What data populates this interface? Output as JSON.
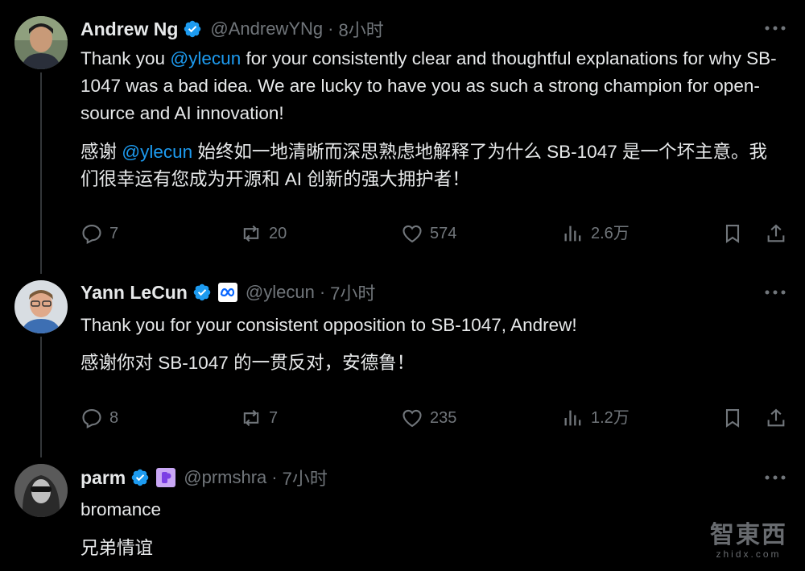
{
  "tweets": [
    {
      "name": "Andrew Ng",
      "handle": "@AndrewYNg",
      "time": "8小时",
      "text_en_pre": "Thank you ",
      "mention_en": "@ylecun",
      "text_en_post": " for your consistently clear and thoughtful explanations for why SB-1047 was a bad idea. We are lucky to have you as such a strong champion for open-source and AI innovation!",
      "text_zh_pre": "感谢 ",
      "mention_zh": "@ylecun",
      "text_zh_post": " 始终如一地清晰而深思熟虑地解释了为什么 SB-1047 是一个坏主意。我们很幸运有您成为开源和 AI 创新的强大拥护者！",
      "replies": "7",
      "reposts": "20",
      "likes": "574",
      "views": "2.6万"
    },
    {
      "name": "Yann LeCun",
      "handle": "@ylecun",
      "time": "7小时",
      "text_en": "Thank you for your consistent opposition to SB-1047, Andrew!",
      "text_zh": "感谢你对 SB-1047 的一贯反对，安德鲁！",
      "replies": "8",
      "reposts": "7",
      "likes": "235",
      "views": "1.2万"
    },
    {
      "name": "parm",
      "handle": "@prmshra",
      "time": "7小时",
      "text_en": "bromance",
      "text_zh": "兄弟情谊"
    }
  ],
  "watermark": {
    "main": "智東西",
    "sub": "zhidx.com"
  },
  "colors": {
    "accent": "#1d9bf0",
    "muted": "#71767b",
    "text": "#e7e9ea",
    "bg": "#000000"
  },
  "icons": [
    "verified-badge-icon",
    "meta-logo-icon",
    "more-icon",
    "reply-icon",
    "repost-icon",
    "like-icon",
    "views-icon",
    "bookmark-icon",
    "share-icon"
  ]
}
